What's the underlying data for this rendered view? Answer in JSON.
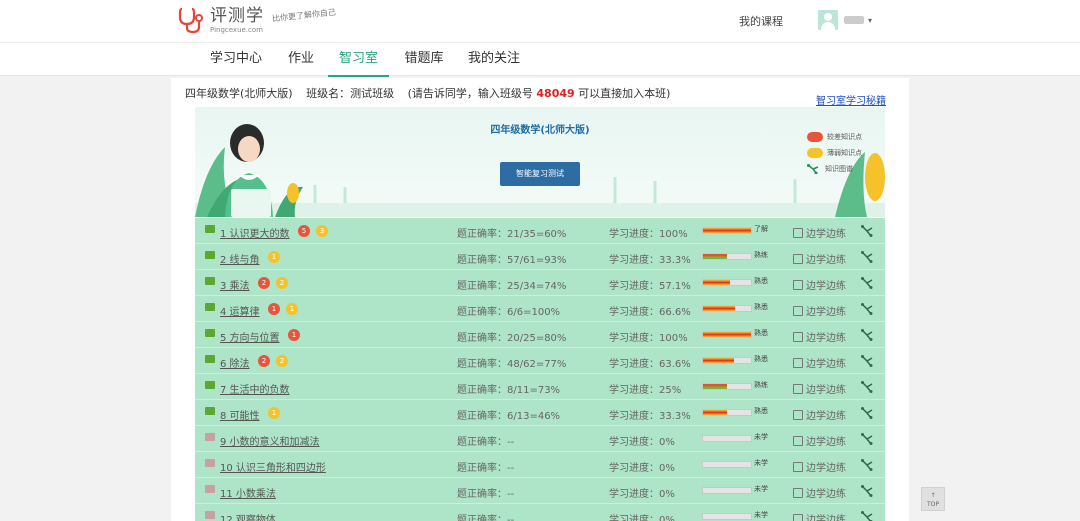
{
  "brand": {
    "name_cn": "评测学",
    "name_en": "Pingcexue.com",
    "slogan": "比你更了解你自己"
  },
  "header": {
    "my_course": "我的课程"
  },
  "nav": {
    "items": [
      "学习中心",
      "作业",
      "智习室",
      "错题库",
      "我的关注"
    ],
    "active": "智习室"
  },
  "class_info": {
    "course": "四年级数学(北师大版)",
    "class_label": "班级名：测试班级",
    "invite_prefix": "(请告诉同学，输入班级号",
    "class_number": "48049",
    "invite_suffix": "可以直接加入本班)",
    "help_link": "智习室学习秘籍"
  },
  "banner": {
    "title": "四年级数学(北师大版)",
    "test_button": "智能复习测试"
  },
  "legend": [
    {
      "label": "较差知识点",
      "color": "#e8553a"
    },
    {
      "label": "薄弱知识点",
      "color": "#f5c22a"
    },
    {
      "label": "知识图谱",
      "icon": "knowledge-graph-icon"
    }
  ],
  "row_labels": {
    "practice": "边学边练"
  },
  "colors": {
    "accent": "#2aa57d",
    "row_bg": "#aee4c8",
    "bad": "#e8553a",
    "weak": "#f5c22a",
    "folder_done": "#5aa830",
    "folder_todo": "#c9a0a0"
  },
  "chapters": [
    {
      "title": "1 认识更大的数",
      "bad": "5",
      "weak": "3",
      "accuracy": "题正确率：21/35=60%",
      "progress": "学习进度：100%",
      "progress_value": 1.0,
      "level": "了解",
      "started": true
    },
    {
      "title": "2 线与角",
      "bad": "",
      "weak": "1",
      "accuracy": "题正确率：57/61=93%",
      "progress": "学习进度：33.3%",
      "progress_value": 0.333,
      "level": "熟练",
      "started": true
    },
    {
      "title": "3 乘法",
      "bad": "2",
      "weak": "2",
      "accuracy": "题正确率：25/34=74%",
      "progress": "学习进度：57.1%",
      "progress_value": 0.571,
      "level": "熟悉",
      "started": true
    },
    {
      "title": "4 运算律",
      "bad": "1",
      "weak": "1",
      "accuracy": "题正确率：6/6=100%",
      "progress": "学习进度：66.6%",
      "progress_value": 0.666,
      "level": "熟悉",
      "started": true
    },
    {
      "title": "5 方向与位置",
      "bad": "1",
      "weak": "",
      "accuracy": "题正确率：20/25=80%",
      "progress": "学习进度：100%",
      "progress_value": 1.0,
      "level": "熟悉",
      "started": true
    },
    {
      "title": "6 除法",
      "bad": "2",
      "weak": "2",
      "accuracy": "题正确率：48/62=77%",
      "progress": "学习进度：63.6%",
      "progress_value": 0.636,
      "level": "熟悉",
      "started": true
    },
    {
      "title": "7 生活中的负数",
      "bad": "",
      "weak": "",
      "accuracy": "题正确率：8/11=73%",
      "progress": "学习进度：25%",
      "progress_value": 0.25,
      "level": "熟练",
      "started": true
    },
    {
      "title": "8 可能性",
      "bad": "",
      "weak": "1",
      "accuracy": "题正确率：6/13=46%",
      "progress": "学习进度：33.3%",
      "progress_value": 0.333,
      "level": "熟悉",
      "started": true
    },
    {
      "title": "9 小数的意义和加减法",
      "bad": "",
      "weak": "",
      "accuracy": "题正确率：--",
      "progress": "学习进度：0%",
      "progress_value": 0,
      "level": "未学",
      "started": false
    },
    {
      "title": "10 认识三角形和四边形",
      "bad": "",
      "weak": "",
      "accuracy": "题正确率：--",
      "progress": "学习进度：0%",
      "progress_value": 0,
      "level": "未学",
      "started": false
    },
    {
      "title": "11 小数乘法",
      "bad": "",
      "weak": "",
      "accuracy": "题正确率：--",
      "progress": "学习进度：0%",
      "progress_value": 0,
      "level": "未学",
      "started": false
    },
    {
      "title": "12 观察物体",
      "bad": "",
      "weak": "",
      "accuracy": "题正确率：--",
      "progress": "学习进度：0%",
      "progress_value": 0,
      "level": "未学",
      "started": false
    }
  ],
  "top_button": "TOP"
}
